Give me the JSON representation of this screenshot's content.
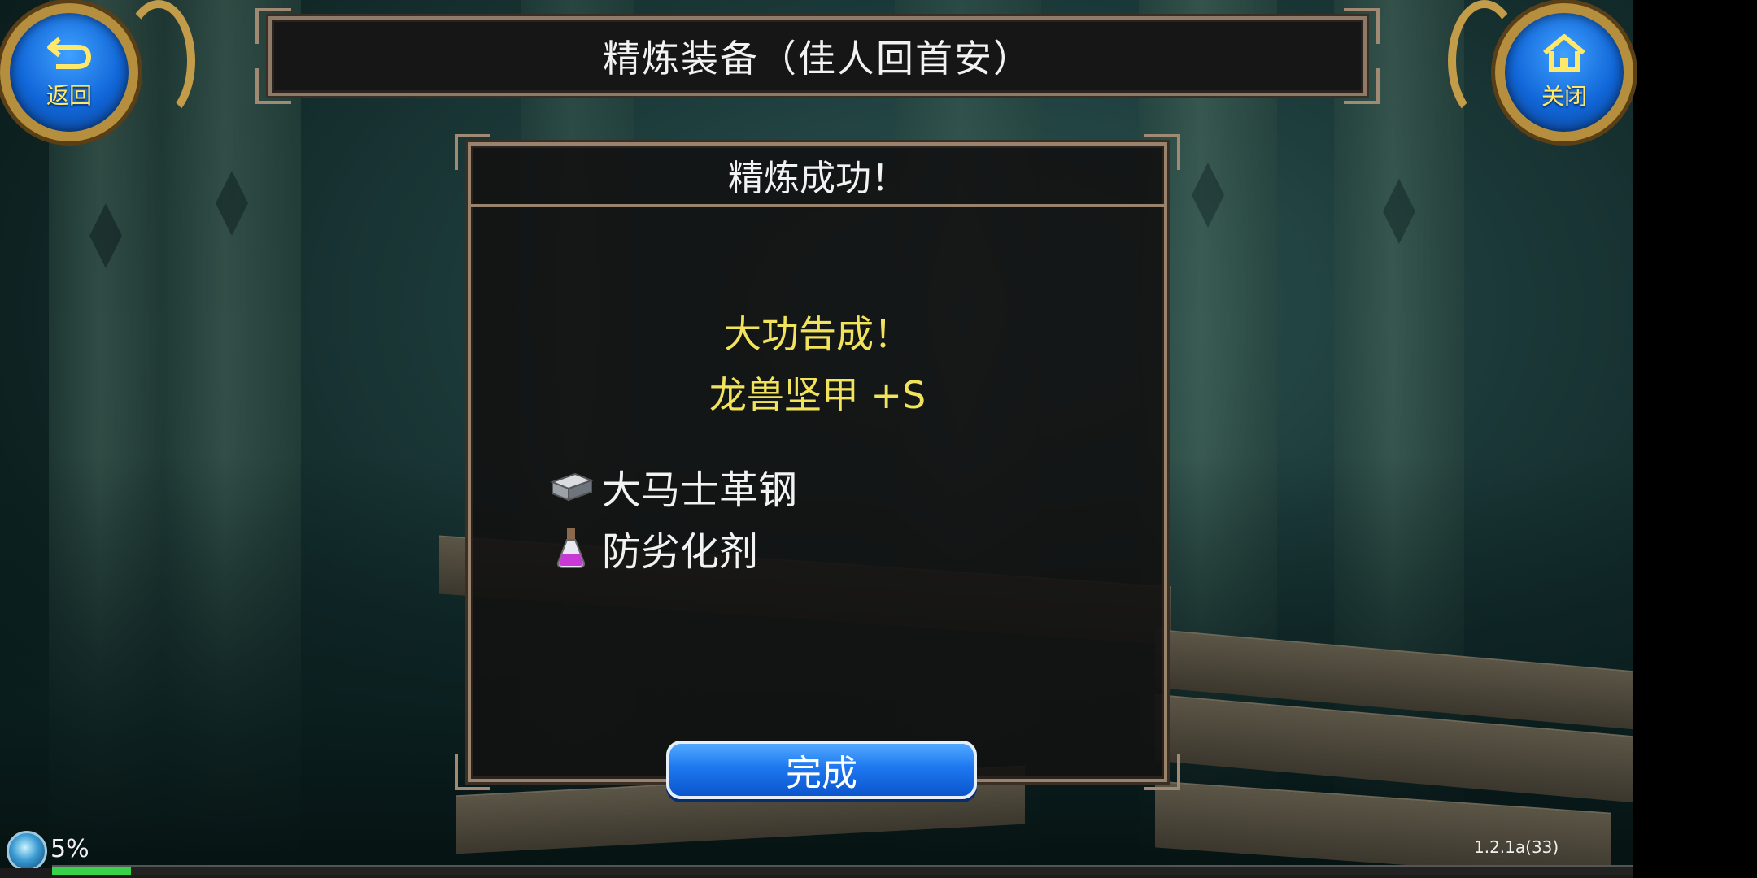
{
  "header": {
    "title": "精炼装备（佳人回首安）",
    "back_label": "返回",
    "close_label": "关闭"
  },
  "dialog": {
    "title": "精炼成功！",
    "result_message": "大功告成！",
    "result_item": "龙兽坚甲 +S",
    "materials": [
      {
        "name": "大马士革钢",
        "icon": "steel-ingot-icon"
      },
      {
        "name": "防劣化剂",
        "icon": "potion-flask-icon"
      }
    ],
    "done_label": "完成"
  },
  "hud": {
    "percent_text": "5%",
    "progress_fraction": 0.05,
    "version": "1.2.1a(33)"
  },
  "colors": {
    "accent_yellow": "#f1e45c",
    "button_blue": "#1d78f0",
    "frame_bronze": "#9a836d",
    "progress_green": "#38d24a"
  }
}
